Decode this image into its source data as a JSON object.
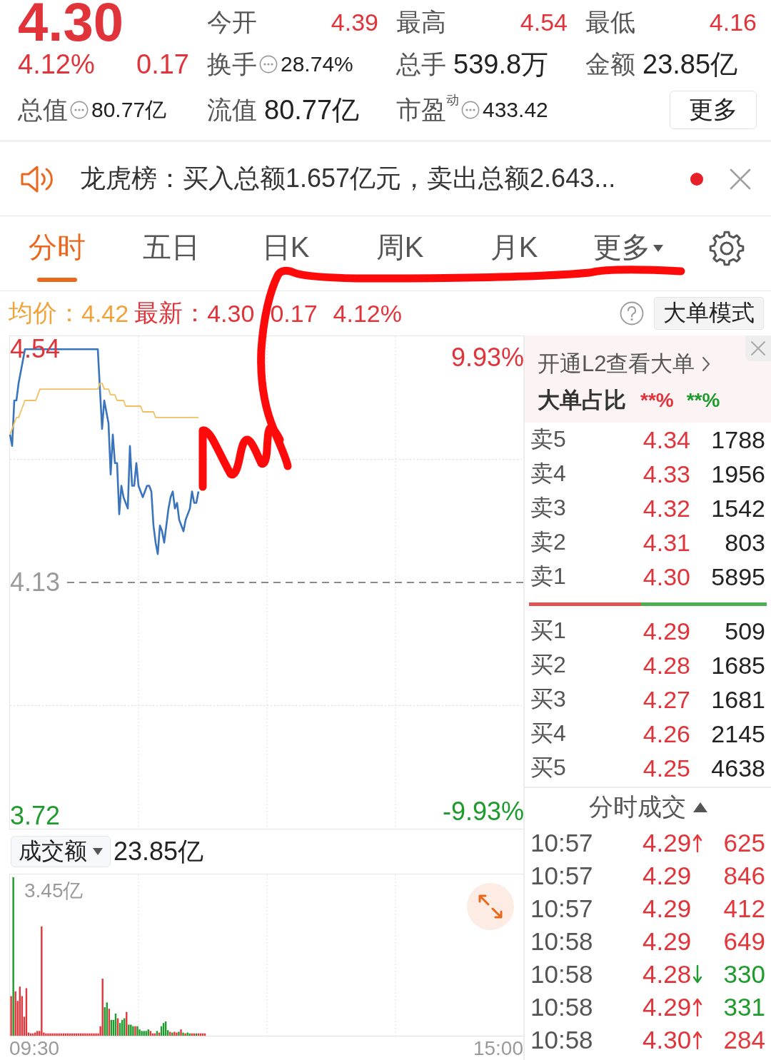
{
  "quote": {
    "price": "4.30",
    "change_pct": "4.12%",
    "change": "0.17",
    "stats": [
      {
        "label": "今开",
        "value": "4.39",
        "kind": "price"
      },
      {
        "label": "最高",
        "value": "4.54",
        "kind": "price"
      },
      {
        "label": "最低",
        "value": "4.16",
        "kind": "price"
      },
      {
        "label": "换手",
        "value": "28.74%",
        "kind": "info"
      },
      {
        "label": "总手",
        "value": "539.8万",
        "kind": "plain"
      },
      {
        "label": "金额",
        "value": "23.85亿",
        "kind": "plain"
      },
      {
        "label": "总值",
        "value": "80.77亿",
        "kind": "info"
      },
      {
        "label": "流值",
        "value": "80.77亿",
        "kind": "plain"
      },
      {
        "label": "市盈$^{动}$",
        "value": "433.42",
        "kind": "info"
      }
    ],
    "more_button": "更多"
  },
  "notice": {
    "text": "龙虎榜：买入总额1.657亿元，卖出总额2.643...",
    "unread": true
  },
  "tabs": [
    {
      "label": "分时",
      "selected": true,
      "menu": false
    },
    {
      "label": "五日",
      "selected": false,
      "menu": false
    },
    {
      "label": "日K",
      "selected": false,
      "menu": false
    },
    {
      "label": "周K",
      "selected": false,
      "menu": false
    },
    {
      "label": "月K",
      "selected": false,
      "menu": false
    },
    {
      "label": "更多",
      "selected": false,
      "menu": true
    }
  ],
  "summary": {
    "avg_value": "4.42",
    "last_value": "4.30",
    "change": "0.17",
    "change_pct": "4.12%",
    "mode_button": "大单模式"
  },
  "chart": {
    "chart_data": {
      "type": "line",
      "categories": [
        null,
        null,
        null,
        null,
        null,
        null,
        null,
        null,
        null,
        null,
        null,
        null,
        null,
        null,
        null,
        null,
        null,
        null,
        null,
        null,
        null,
        null,
        null,
        null,
        null,
        null,
        null,
        null,
        null,
        null,
        null,
        null,
        null,
        null,
        null,
        null,
        null,
        null,
        null,
        null,
        null,
        null,
        null,
        null,
        null,
        null,
        null,
        null,
        null,
        null,
        null,
        null,
        null,
        null,
        null,
        null,
        null,
        null,
        null,
        null,
        null,
        null,
        null,
        null,
        null,
        null,
        null,
        null,
        null,
        null,
        null,
        null,
        null,
        null,
        null,
        null,
        null,
        null,
        null,
        null,
        null,
        null,
        null,
        null,
        null,
        null,
        null,
        null,
        null,
        null,
        null,
        null,
        null,
        null,
        null,
        null,
        null,
        null,
        null,
        null,
        null,
        null,
        null,
        null,
        null,
        null,
        null,
        null,
        null,
        null,
        null,
        null,
        null,
        null,
        null,
        null,
        null,
        null,
        null,
        null,
        null,
        null,
        null,
        null,
        null,
        null,
        null,
        null,
        null,
        null,
        null,
        null,
        null,
        null,
        null,
        null,
        null,
        null,
        null,
        null,
        null,
        null,
        null,
        null,
        null,
        null,
        null,
        null,
        null,
        null,
        null,
        null,
        null,
        null,
        null,
        null,
        null,
        null,
        null,
        null,
        null,
        null,
        null,
        null,
        null,
        null,
        null,
        null,
        null,
        null,
        null,
        null,
        null,
        null,
        null,
        null,
        null,
        null,
        null,
        null,
        null,
        null,
        null,
        null,
        null,
        null,
        null,
        null,
        null,
        null,
        null,
        null,
        null,
        null,
        null,
        null,
        null,
        null,
        null,
        null,
        null,
        null,
        null,
        null,
        null,
        null,
        null,
        null,
        null,
        null,
        null,
        null,
        null,
        null,
        null,
        null,
        null,
        null,
        null,
        null,
        null,
        null,
        null,
        null,
        null,
        null,
        null,
        null,
        null,
        null,
        null,
        null,
        null,
        null,
        null,
        null,
        null,
        null,
        null,
        null,
        null
      ],
      "series": [
        {
          "name": "最新：",
          "color": "#3a74bd",
          "values": [
            4.39,
            4.37,
            4.45,
            4.45,
            4.48,
            4.5,
            4.52,
            4.54,
            4.54,
            4.54,
            4.54,
            4.54,
            4.54,
            4.54,
            4.54,
            4.54,
            4.54,
            4.54,
            4.54,
            4.54,
            4.54,
            4.54,
            4.54,
            4.54,
            4.54,
            4.54,
            4.54,
            4.54,
            4.54,
            4.54,
            4.54,
            4.54,
            4.54,
            4.54,
            4.54,
            4.54,
            4.54,
            4.54,
            4.54,
            4.54,
            4.54,
            4.54,
            4.47,
            4.4,
            4.45,
            4.43,
            4.41,
            4.32,
            4.39,
            4.34,
            4.34,
            4.25,
            4.3,
            4.28,
            4.27,
            4.26,
            4.37,
            4.3,
            4.3,
            4.34,
            4.3,
            4.29,
            4.28,
            4.29,
            4.3,
            4.3,
            4.29,
            4.23,
            4.2,
            4.18,
            4.23,
            4.22,
            4.2,
            4.23,
            4.26,
            4.28,
            4.29,
            4.26,
            4.27,
            4.24,
            4.23,
            4.22,
            4.24,
            4.25,
            4.26,
            4.29,
            4.27,
            4.27,
            4.29,
            null,
            null,
            null,
            null,
            null,
            null,
            null,
            null,
            null,
            null,
            null,
            null,
            null,
            null,
            null,
            null,
            null,
            null,
            null,
            null,
            null,
            null,
            null,
            null,
            null,
            null,
            null,
            null,
            null,
            null,
            null,
            null,
            null,
            null,
            null,
            null,
            null,
            null,
            null,
            null,
            null,
            null,
            null,
            null,
            null,
            null,
            null,
            null,
            null,
            null,
            null,
            null,
            null,
            null,
            null,
            null,
            null,
            null,
            null,
            null,
            null,
            null,
            null,
            null,
            null,
            null,
            null,
            null,
            null,
            null,
            null,
            null,
            null,
            null,
            null,
            null,
            null,
            null,
            null,
            null,
            null,
            null,
            null,
            null,
            null,
            null,
            null,
            null,
            null,
            null,
            null,
            null,
            null,
            null,
            null,
            null,
            null,
            null,
            null,
            null,
            null,
            null,
            null,
            null,
            null,
            null,
            null,
            null,
            null,
            null,
            null,
            null,
            null,
            null,
            null,
            null,
            null,
            null,
            null,
            null,
            null,
            null,
            null,
            null,
            null,
            null,
            null,
            null,
            null,
            null,
            null,
            null,
            null,
            null,
            null,
            null,
            null,
            null,
            null,
            null,
            null,
            null,
            null,
            null,
            null,
            null,
            null,
            null,
            null,
            null,
            null,
            null
          ]
        },
        {
          "name": "均价：",
          "color": "#f2c063",
          "values": [
            4.39,
            4.4,
            4.41,
            4.42,
            4.42,
            4.43,
            4.44,
            4.45,
            4.45,
            4.45,
            4.45,
            4.45,
            4.45,
            4.46,
            4.47,
            4.47,
            4.47,
            4.47,
            4.47,
            4.47,
            4.47,
            4.47,
            4.47,
            4.47,
            4.47,
            4.47,
            4.47,
            4.47,
            4.47,
            4.47,
            4.47,
            4.47,
            4.47,
            4.47,
            4.47,
            4.47,
            4.47,
            4.47,
            4.47,
            4.47,
            4.47,
            4.47,
            4.48,
            4.48,
            4.47,
            4.47,
            4.47,
            4.46,
            4.46,
            4.46,
            4.45,
            4.45,
            4.45,
            4.45,
            4.44,
            4.44,
            4.44,
            4.44,
            4.44,
            4.44,
            4.44,
            4.44,
            4.43,
            4.43,
            4.43,
            4.43,
            4.43,
            4.43,
            4.42,
            4.42,
            4.42,
            4.42,
            4.42,
            4.42,
            4.42,
            4.42,
            4.42,
            4.42,
            4.42,
            4.42,
            4.42,
            4.42,
            4.42,
            4.42,
            4.42,
            4.42,
            4.42,
            4.42,
            4.42,
            null,
            null,
            null,
            null,
            null,
            null,
            null,
            null,
            null,
            null,
            null,
            null,
            null,
            null,
            null,
            null,
            null,
            null,
            null,
            null,
            null,
            null,
            null,
            null,
            null,
            null,
            null,
            null,
            null,
            null,
            null,
            null,
            null,
            null,
            null,
            null,
            null,
            null,
            null,
            null,
            null,
            null,
            null,
            null,
            null,
            null,
            null,
            null,
            null,
            null,
            null,
            null,
            null,
            null,
            null,
            null,
            null,
            null,
            null,
            null,
            null,
            null,
            null,
            null,
            null,
            null,
            null,
            null,
            null,
            null,
            null,
            null,
            null,
            null,
            null,
            null,
            null,
            null,
            null,
            null,
            null,
            null,
            null,
            null,
            null,
            null,
            null,
            null,
            null,
            null,
            null,
            null,
            null,
            null,
            null,
            null,
            null,
            null,
            null,
            null,
            null,
            null,
            null,
            null,
            null,
            null,
            null,
            null,
            null,
            null,
            null,
            null,
            null,
            null,
            null,
            null,
            null,
            null,
            null,
            null,
            null,
            null,
            null,
            null,
            null,
            null,
            null,
            null,
            null,
            null,
            null,
            null,
            null,
            null,
            null,
            null,
            null,
            null,
            null,
            null,
            null,
            null,
            null,
            null,
            null,
            null,
            null,
            null,
            null,
            null,
            null,
            null
          ]
        }
      ],
      "ylim": [
        3.697,
        4.563
      ],
      "yticks": [
        4.54,
        4.13,
        3.72
      ],
      "ref_lines": [
        {
          "axis": "y",
          "value": 4.13
        }
      ]
    },
    "right_labels": [
      "9.93%",
      "-9.93%"
    ]
  },
  "volume": {
    "metric": "成交额",
    "total": "23.85亿",
    "scale_label": "3.45亿",
    "time_labels": [
      "09:30",
      "15:00"
    ]
  },
  "l2_promo": {
    "link": "开通L2查看大单",
    "ratio_label": "大单占比",
    "buy_ratio": "**%",
    "sell_ratio": "**%"
  },
  "order_book": {
    "asks": [
      {
        "label": "卖5",
        "price": "4.34",
        "volume": "1788"
      },
      {
        "label": "卖4",
        "price": "4.33",
        "volume": "1956"
      },
      {
        "label": "卖3",
        "price": "4.32",
        "volume": "1542"
      },
      {
        "label": "卖2",
        "price": "4.31",
        "volume": "803"
      },
      {
        "label": "卖1",
        "price": "4.30",
        "volume": "5895"
      }
    ],
    "balance": {
      "level": 0.47
    },
    "bids": [
      {
        "label": "买1",
        "price": "4.29",
        "volume": "509"
      },
      {
        "label": "买2",
        "price": "4.28",
        "volume": "1685"
      },
      {
        "label": "买3",
        "price": "4.27",
        "volume": "1681"
      },
      {
        "label": "买4",
        "price": "4.26",
        "volume": "2145"
      },
      {
        "label": "买5",
        "price": "4.25",
        "volume": "4638"
      }
    ]
  },
  "trades": {
    "title": "分时成交",
    "rows": [
      {
        "time": "10:57",
        "price": "4.29",
        "uptick": true,
        "downtick": false,
        "volume": "625",
        "color": "#e3373c"
      },
      {
        "time": "10:57",
        "price": "4.29",
        "uptick": false,
        "downtick": false,
        "volume": "846",
        "color": "#e3373c"
      },
      {
        "time": "10:57",
        "price": "4.29",
        "uptick": false,
        "downtick": false,
        "volume": "412",
        "color": "#e3373c"
      },
      {
        "time": "10:58",
        "price": "4.29",
        "uptick": false,
        "downtick": false,
        "volume": "649",
        "color": "#e3373c"
      },
      {
        "time": "10:58",
        "price": "4.28",
        "uptick": false,
        "downtick": true,
        "volume": "330",
        "color": "#1e9b2d"
      },
      {
        "time": "10:58",
        "price": "4.29",
        "uptick": true,
        "downtick": false,
        "volume": "331",
        "color": "#1e9b2d"
      },
      {
        "time": "10:58",
        "price": "4.30",
        "uptick": true,
        "downtick": false,
        "volume": "284",
        "color": "#e3373c"
      }
    ]
  },
  "annotation": {
    "kind": "freehand"
  }
}
